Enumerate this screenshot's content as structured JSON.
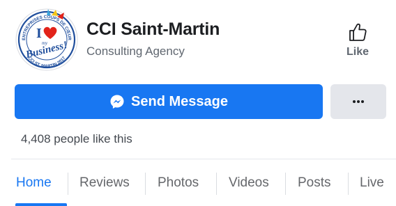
{
  "header": {
    "page_name": "CCI Saint-Martin",
    "category": "Consulting Agency",
    "avatar": {
      "logo_line_1": "I",
      "logo_line_2": "my",
      "logo_line_3": "Business!",
      "ring_text_top": "ENTREPRISES COUPS DE CŒUR",
      "ring_text_bottom": "CCI ST. MARTIN 2017"
    },
    "like": {
      "label": "Like",
      "icon": "thumbs-up-icon"
    }
  },
  "actions": {
    "send_message_label": "Send Message",
    "send_message_icon": "messenger-icon",
    "more_icon": "more-icon"
  },
  "stats": {
    "likes_text": "4,408 people like this"
  },
  "tabs": [
    {
      "label": "Home",
      "active": true
    },
    {
      "label": "Reviews",
      "active": false
    },
    {
      "label": "Photos",
      "active": false
    },
    {
      "label": "Videos",
      "active": false
    },
    {
      "label": "Posts",
      "active": false
    },
    {
      "label": "Live",
      "active": false
    }
  ],
  "colors": {
    "accent": "#1877f2",
    "text_primary": "#1c1e21",
    "text_secondary": "#65676b",
    "button_secondary_bg": "#e4e6eb",
    "logo_heart": "#e2231a",
    "logo_blue": "#1f4e9c"
  }
}
